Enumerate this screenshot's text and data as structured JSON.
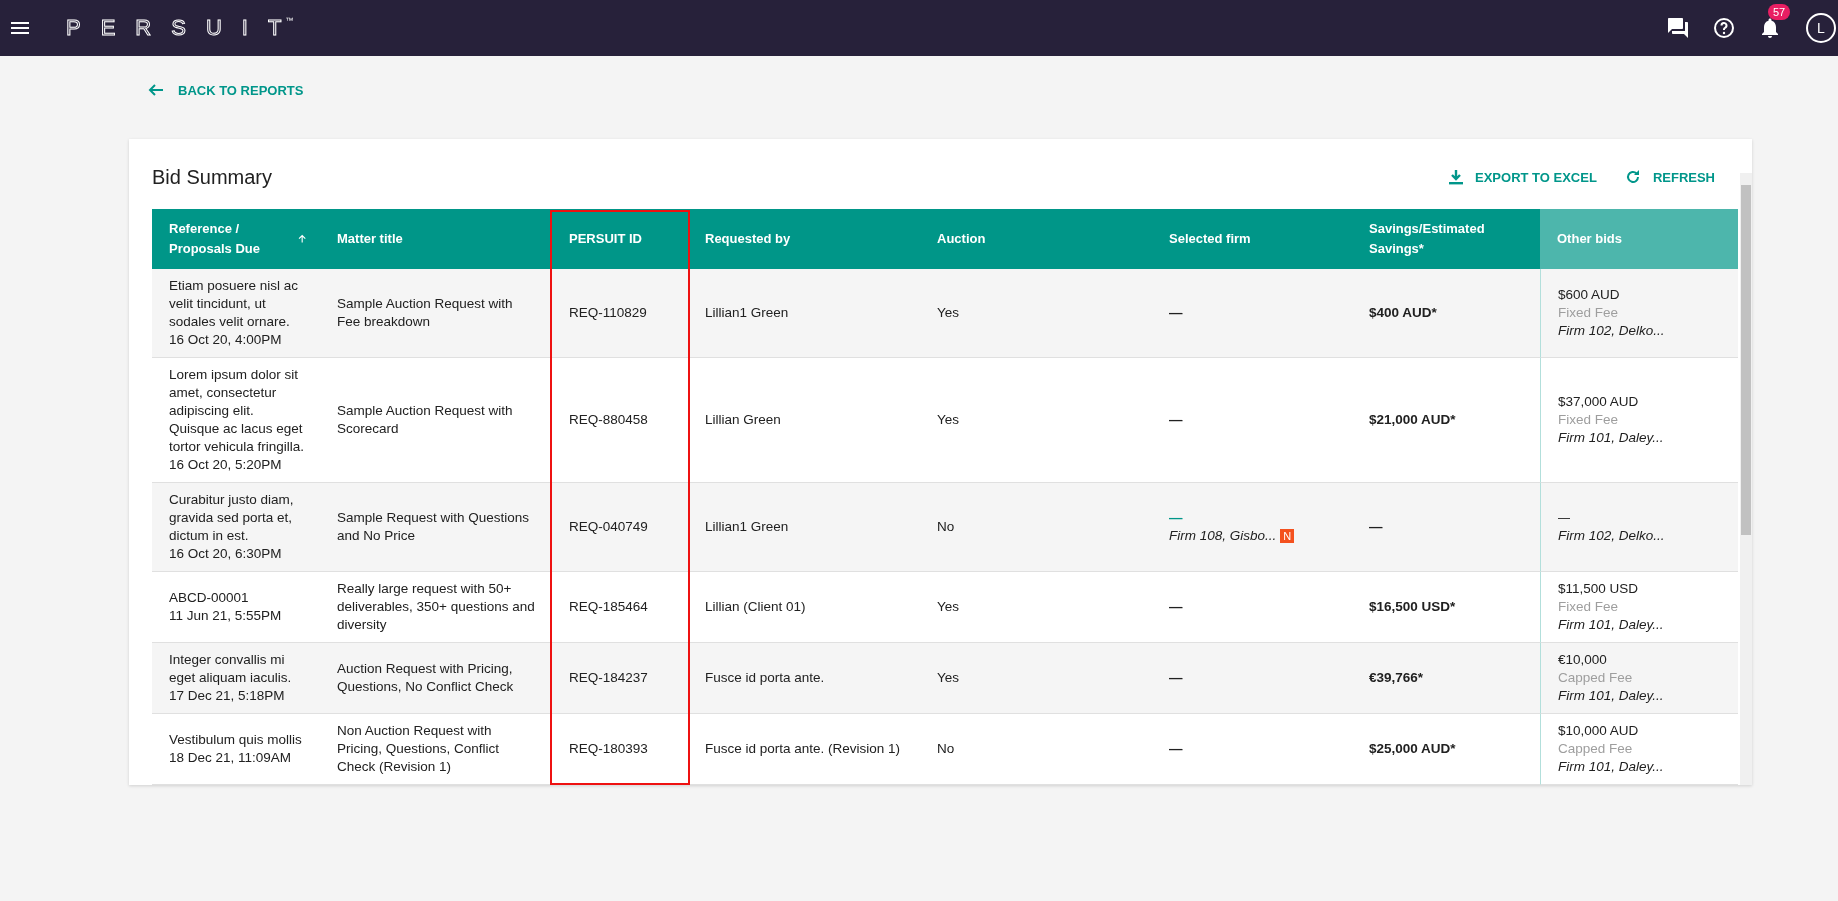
{
  "topbar": {
    "logo": "PERSUIT",
    "logo_mark": "™",
    "notifications": "57",
    "avatar": "L"
  },
  "back_link": "BACK TO REPORTS",
  "card": {
    "title": "Bid Summary",
    "actions": [
      {
        "kind": "export",
        "label": "EXPORT TO EXCEL"
      },
      {
        "kind": "refresh",
        "label": "REFRESH"
      }
    ]
  },
  "table": {
    "columns": [
      {
        "label": "Reference / Proposals Due",
        "sorted": true,
        "pinned": false,
        "highlighted": false
      },
      {
        "label": "Matter title",
        "sorted": false,
        "pinned": false,
        "highlighted": false
      },
      {
        "label": "PERSUIT ID",
        "sorted": false,
        "pinned": false,
        "highlighted": true
      },
      {
        "label": "Requested by",
        "sorted": false,
        "pinned": false,
        "highlighted": false
      },
      {
        "label": "Auction",
        "sorted": false,
        "pinned": false,
        "highlighted": false
      },
      {
        "label": "Selected firm",
        "sorted": false,
        "pinned": false,
        "highlighted": false
      },
      {
        "label": "Savings/Estimated Savings*",
        "sorted": false,
        "pinned": false,
        "highlighted": false
      },
      {
        "label": "Other bids",
        "sorted": false,
        "pinned": true,
        "highlighted": false
      }
    ],
    "rows": [
      {
        "reference": "Etiam posuere nisl ac velit tincidunt, ut sodales velit ornare.",
        "due": "16 Oct 20, 4:00PM",
        "matter": "Sample Auction Request with Fee breakdown",
        "id": "REQ-110829",
        "requested_by": "Lillian1 Green",
        "auction": "Yes",
        "selected_firm": {
          "value": "—"
        },
        "savings": "$400 AUD*",
        "other_bids": {
          "amount": "$600 AUD",
          "fee_type": "Fixed Fee",
          "firm": "Firm 102, Delko..."
        }
      },
      {
        "reference": "Lorem ipsum dolor sit amet, consectetur adipiscing elit. Quisque ac lacus eget tortor vehicula fringilla.",
        "due": "16 Oct 20, 5:20PM",
        "matter": "Sample Auction Request with Scorecard",
        "id": "REQ-880458",
        "requested_by": "Lillian Green",
        "auction": "Yes",
        "selected_firm": {
          "value": "—"
        },
        "savings": "$21,000 AUD*",
        "other_bids": {
          "amount": "$37,000 AUD",
          "fee_type": "Fixed Fee",
          "firm": "Firm 101, Daley..."
        }
      },
      {
        "reference": "Curabitur justo diam, gravida sed porta et, dictum in est.",
        "due": "16 Oct 20, 6:30PM",
        "matter": "Sample Request with Questions and No Price",
        "id": "REQ-040749",
        "requested_by": "Lillian1 Green",
        "auction": "No",
        "selected_firm": {
          "value": "—",
          "firm": "Firm 108, Gisbo...",
          "badge": "N"
        },
        "savings": "—",
        "other_bids": {
          "amount": "—",
          "firm": "Firm 102, Delko..."
        }
      },
      {
        "reference": "ABCD-00001",
        "due": "11 Jun 21, 5:55PM",
        "matter": "Really large request with 50+ deliverables, 350+ questions and diversity",
        "id": "REQ-185464",
        "requested_by": "Lillian (Client 01)",
        "auction": "Yes",
        "selected_firm": {
          "value": "—"
        },
        "savings": "$16,500 USD*",
        "other_bids": {
          "amount": "$11,500 USD",
          "fee_type": "Fixed Fee",
          "firm": "Firm 101, Daley..."
        }
      },
      {
        "reference": "Integer convallis mi eget aliquam iaculis.",
        "due": "17 Dec 21, 5:18PM",
        "matter": "Auction Request with Pricing, Questions, No Conflict Check",
        "id": "REQ-184237",
        "requested_by": "Fusce id porta ante.",
        "auction": "Yes",
        "selected_firm": {
          "value": "—"
        },
        "savings": "€39,766*",
        "other_bids": {
          "amount": "€10,000",
          "fee_type": "Capped Fee",
          "firm": "Firm 101, Daley..."
        }
      },
      {
        "reference": "Vestibulum quis mollis",
        "due": "18 Dec 21, 11:09AM",
        "matter": "Non Auction Request with Pricing, Questions, Conflict Check (Revision 1)",
        "id": "REQ-180393",
        "requested_by": "Fusce id porta ante. (Revision 1)",
        "auction": "No",
        "selected_firm": {
          "value": "—"
        },
        "savings": "$25,000 AUD*",
        "other_bids": {
          "amount": "$10,000 AUD",
          "fee_type": "Capped Fee",
          "firm": "Firm 101, Daley..."
        }
      }
    ]
  }
}
